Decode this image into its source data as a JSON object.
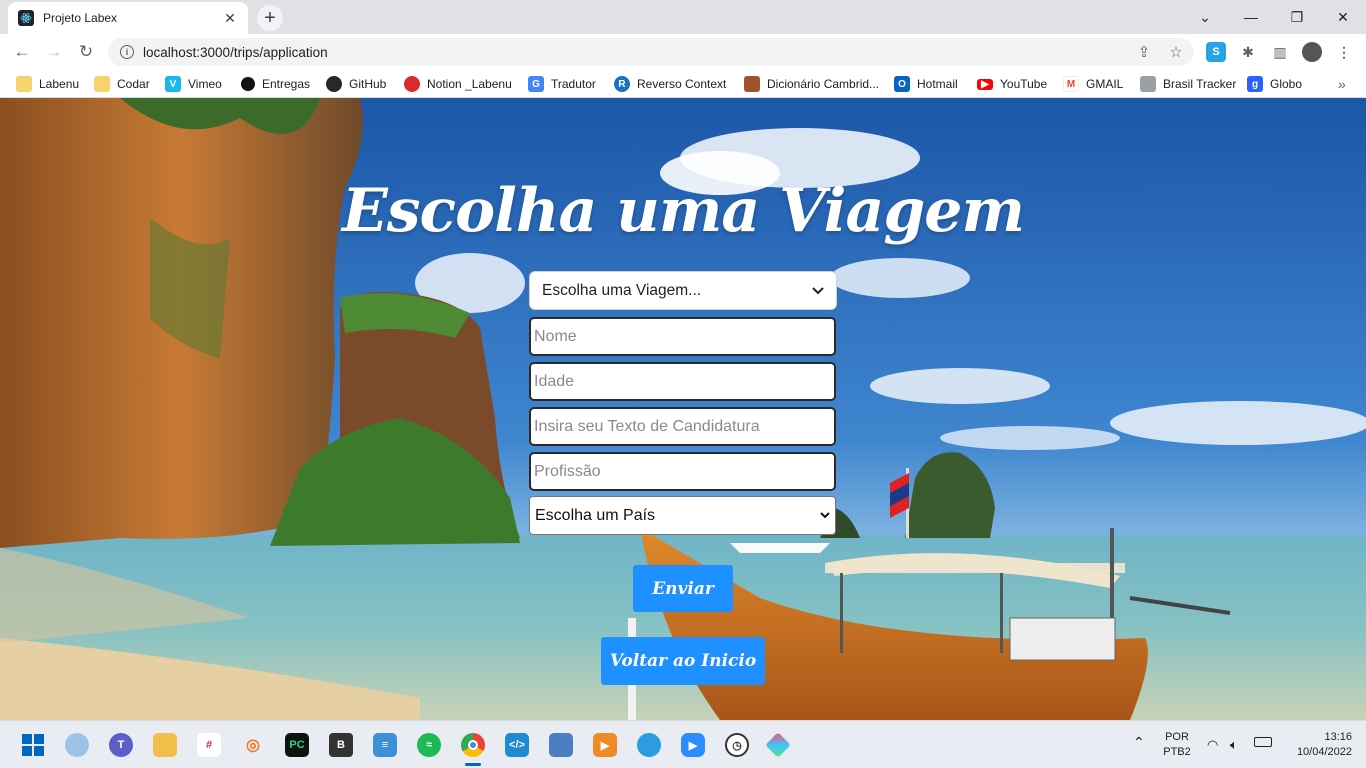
{
  "browser": {
    "tab_title": "Projeto Labex",
    "tab_close": "✕",
    "new_tab": "+",
    "url": "localhost:3000/trips/application",
    "bookmarks": [
      {
        "label": "Labenu",
        "icon": "folder-icon",
        "color": "#f6d36b"
      },
      {
        "label": "Codar",
        "icon": "folder-icon",
        "color": "#f6d36b"
      },
      {
        "label": "Vimeo",
        "icon": "vimeo-icon",
        "color": "#1ab7ea"
      },
      {
        "label": "Entregas",
        "icon": "circle-icon",
        "color": "#111111"
      },
      {
        "label": "GitHub",
        "icon": "github-icon",
        "color": "#24292e"
      },
      {
        "label": "Notion _Labenu",
        "icon": "apple-icon",
        "color": "#d92b2b"
      },
      {
        "label": "Tradutor",
        "icon": "translate-icon",
        "color": "#4285f4"
      },
      {
        "label": "Reverso Context",
        "icon": "reverso-icon",
        "color": "#1a73c8"
      },
      {
        "label": "Dicionário Cambrid...",
        "icon": "cambridge-icon",
        "color": "#a0522d"
      },
      {
        "label": "Hotmail",
        "icon": "outlook-icon",
        "color": "#0a64c8"
      },
      {
        "label": "YouTube",
        "icon": "youtube-icon",
        "color": "#ff0000"
      },
      {
        "label": "GMAIL",
        "icon": "gmail-icon",
        "color": "#ea4335"
      },
      {
        "label": "Brasil Tracker",
        "icon": "lock-icon",
        "color": "#9aa0a6"
      },
      {
        "label": "Globo",
        "icon": "globo-icon",
        "color": "#2962ff"
      }
    ],
    "more_bookmarks": "»"
  },
  "page": {
    "title": "Escolha uma Viagem",
    "trip_select": "Escolha uma Viagem...",
    "name_placeholder": "Nome",
    "age_placeholder": "Idade",
    "text_placeholder": "Insira seu Texto de Candidatura",
    "profession_placeholder": "Profissão",
    "country_select": "Escolha um País",
    "submit_label": "Enviar",
    "back_label": "Voltar ao Inicio",
    "accent_color": "#1e90ff"
  },
  "taskbar": {
    "apps": [
      "windows-start-icon",
      "weather-icon",
      "teams-icon",
      "file-explorer-icon",
      "slack-icon",
      "jupyter-icon",
      "pycharm-icon",
      "bootstrap-studio-icon",
      "notepad-icon",
      "spotify-icon",
      "chrome-icon",
      "vscode-icon",
      "photos-icon",
      "video-editor-icon",
      "edge-icon",
      "zoom-icon",
      "clock-icon",
      "gitkraken-icon"
    ],
    "language_top": "POR",
    "language_bottom": "PTB2",
    "time": "13:16",
    "date": "10/04/2022"
  }
}
